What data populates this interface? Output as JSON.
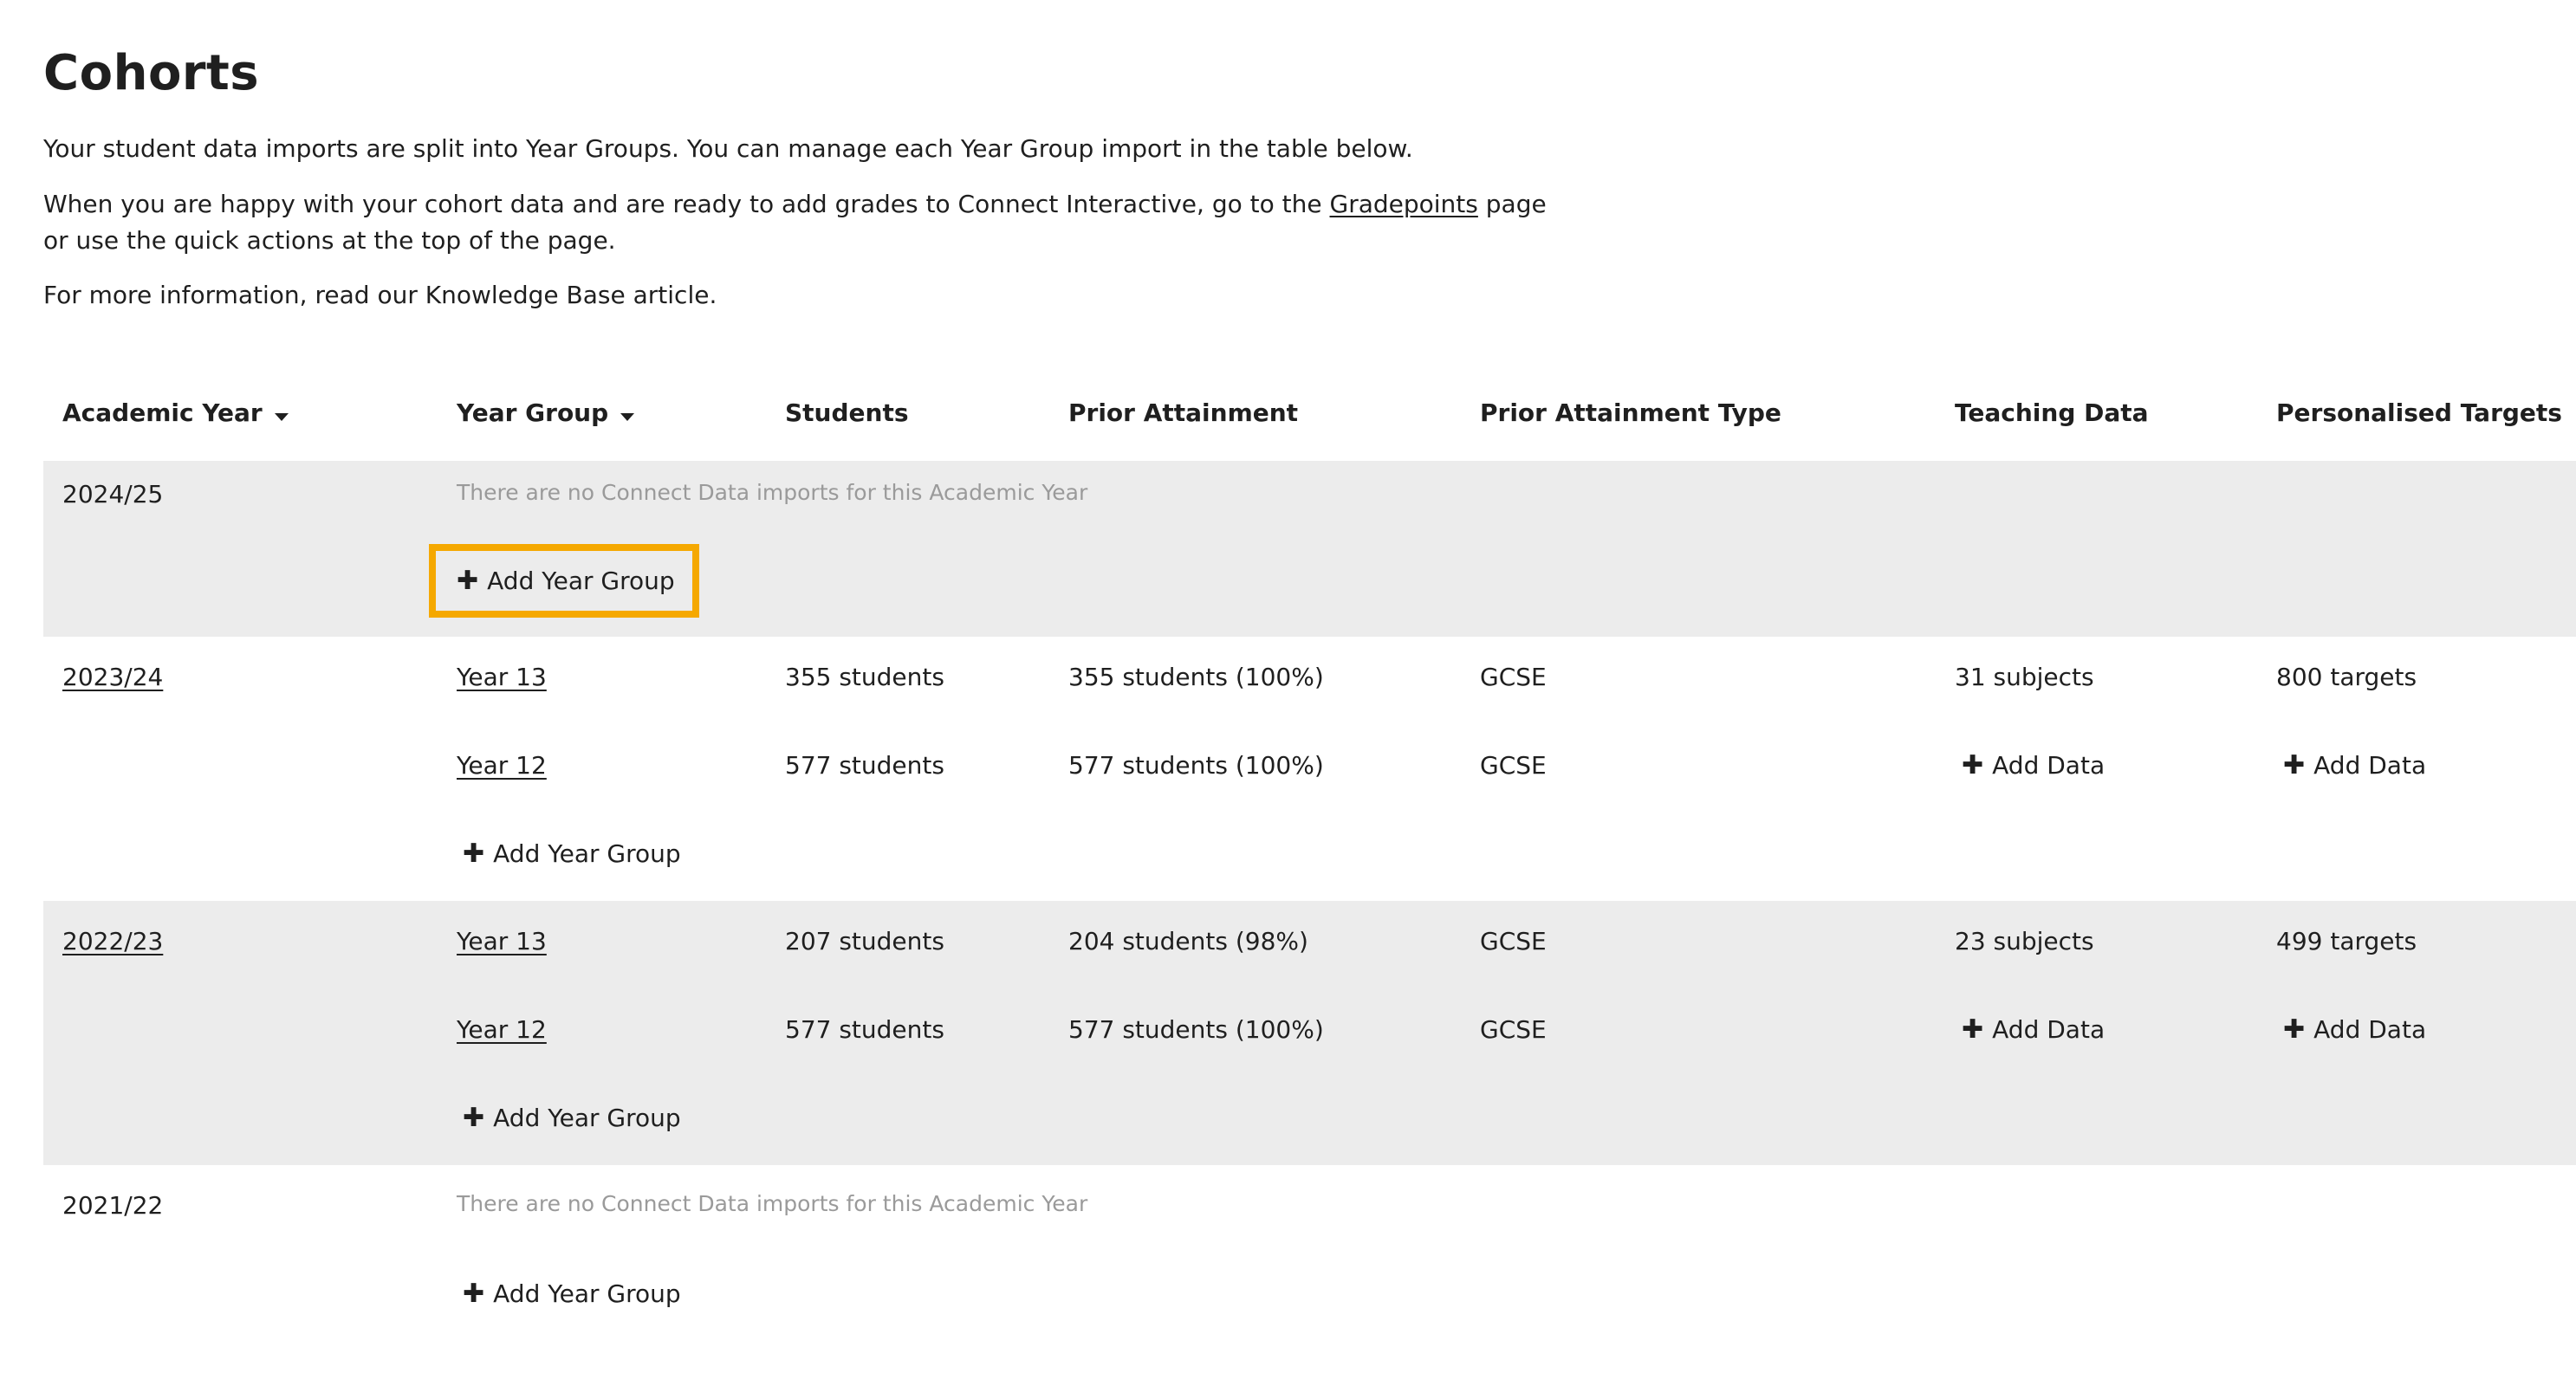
{
  "page": {
    "title": "Cohorts",
    "p1": "Your student data imports are split into Year Groups. You can manage each Year Group import in the table below.",
    "p2_before": "When you are happy with your cohort data and are ready to add grades to Connect Interactive, go to the ",
    "p2_link": "Gradepoints",
    "p2_after": " page or use the quick actions at the top of the page.",
    "p3": "For more information, read our Knowledge Base article."
  },
  "table": {
    "headers": {
      "academic_year": "Academic Year",
      "year_group": "Year Group",
      "students": "Students",
      "prior_attainment": "Prior Attainment",
      "prior_attainment_type": "Prior Attainment Type",
      "teaching_data": "Teaching Data",
      "personalised_targets": "Personalised Targets"
    },
    "empty_message": "There are no Connect Data imports for this Academic Year",
    "add_year_group_label": "Add Year Group",
    "add_data_label": "Add Data",
    "years": [
      {
        "year": "2024/25",
        "rows": []
      },
      {
        "year": "2023/24",
        "rows": [
          {
            "group": "Year 13",
            "students": "355 students",
            "prior": "355 students (100%)",
            "type": "GCSE",
            "teaching": "31 subjects",
            "targets": "800 targets"
          },
          {
            "group": "Year 12",
            "students": "577 students",
            "prior": "577 students (100%)",
            "type": "GCSE",
            "teaching": "Add Data",
            "targets": "Add Data"
          }
        ]
      },
      {
        "year": "2022/23",
        "rows": [
          {
            "group": "Year 13",
            "students": "207 students",
            "prior": "204 students (98%)",
            "type": "GCSE",
            "teaching": "23 subjects",
            "targets": "499 targets"
          },
          {
            "group": "Year 12",
            "students": "577 students",
            "prior": "577 students (100%)",
            "type": "GCSE",
            "teaching": "Add Data",
            "targets": "Add Data"
          }
        ]
      },
      {
        "year": "2021/22",
        "rows": []
      }
    ]
  },
  "colors": {
    "highlight": "#f5a800",
    "shaded_row": "#ececec",
    "muted_text": "#9a9a9a"
  },
  "icons": {
    "sort": "sort-down-caret-icon",
    "add": "plus-icon"
  }
}
